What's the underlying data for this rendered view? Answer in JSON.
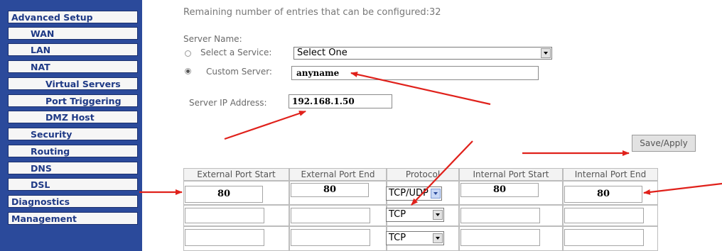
{
  "sidebar": {
    "items": [
      {
        "label": "Advanced Setup",
        "level": 0
      },
      {
        "label": "WAN",
        "level": 1
      },
      {
        "label": "LAN",
        "level": 1
      },
      {
        "label": "NAT",
        "level": 1
      },
      {
        "label": "Virtual Servers",
        "level": 2
      },
      {
        "label": "Port Triggering",
        "level": 2
      },
      {
        "label": "DMZ Host",
        "level": 2
      },
      {
        "label": "Security",
        "level": 1
      },
      {
        "label": "Routing",
        "level": 1
      },
      {
        "label": "DNS",
        "level": 1
      },
      {
        "label": "DSL",
        "level": 1
      },
      {
        "label": "Diagnostics",
        "level": 0
      },
      {
        "label": "Management",
        "level": 0
      }
    ]
  },
  "form": {
    "remaining_text": "Remaining number of entries that can be configured:32",
    "server_name_label": "Server Name:",
    "select_service_label": "Select a Service:",
    "select_service_value": "Select One",
    "custom_server_label": "Custom Server:",
    "custom_server_value": "anyname",
    "server_ip_label": "Server IP Address:",
    "server_ip_value": "192.168.1.50",
    "save_button": "Save/Apply"
  },
  "table": {
    "headers": [
      "External Port Start",
      "External Port End",
      "Protocol",
      "Internal Port Start",
      "Internal Port End"
    ],
    "rows": [
      {
        "ext_start": "80",
        "ext_end": "80",
        "protocol": "TCP/UDP",
        "int_start": "80",
        "int_end": "80"
      },
      {
        "ext_start": "",
        "ext_end": "",
        "protocol": "TCP",
        "int_start": "",
        "int_end": ""
      },
      {
        "ext_start": "",
        "ext_end": "",
        "protocol": "TCP",
        "int_start": "",
        "int_end": ""
      }
    ]
  },
  "colors": {
    "sidebar_background": "#2b4a9b",
    "nav_text": "#1f3a86",
    "annotation_arrow": "#e0211b"
  }
}
